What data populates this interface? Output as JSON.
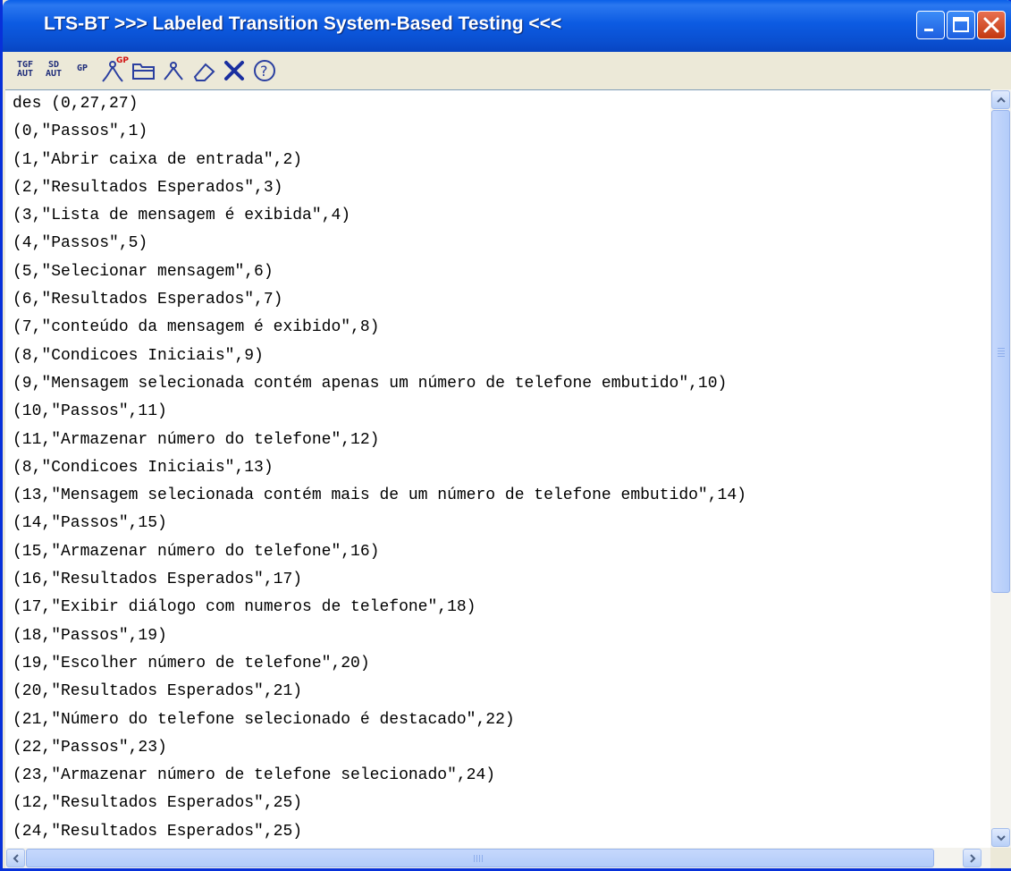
{
  "window": {
    "title": "LTS-BT >>> Labeled Transition System-Based Testing <<<",
    "accent": "#0A5FE8"
  },
  "toolbar": {
    "items": [
      {
        "label_top": "TGF",
        "label_bottom": "AUT",
        "icon": "tgf-aut-icon"
      },
      {
        "label_top": "SD",
        "label_bottom": "AUT",
        "icon": "sd-aut-icon"
      },
      {
        "label_top": "GP",
        "label_bottom": "",
        "icon": "gp-icon"
      },
      {
        "label_top": "GP",
        "label_bottom": "",
        "icon": "graph-gp-icon"
      },
      {
        "label_top": "",
        "label_bottom": "",
        "icon": "open-folder-icon"
      },
      {
        "label_top": "",
        "label_bottom": "",
        "icon": "graph-icon"
      },
      {
        "label_top": "",
        "label_bottom": "",
        "icon": "eraser-icon"
      },
      {
        "label_top": "",
        "label_bottom": "",
        "icon": "close-x-icon"
      },
      {
        "label_top": "",
        "label_bottom": "",
        "icon": "help-icon"
      }
    ]
  },
  "editor": {
    "lines": [
      "des (0,27,27)",
      "(0,\"Passos\",1)",
      "(1,\"Abrir caixa de entrada\",2)",
      "(2,\"Resultados Esperados\",3)",
      "(3,\"Lista de mensagem é exibida\",4)",
      "(4,\"Passos\",5)",
      "(5,\"Selecionar mensagem\",6)",
      "(6,\"Resultados Esperados\",7)",
      "(7,\"conteúdo da mensagem é exibido\",8)",
      "(8,\"Condicoes Iniciais\",9)",
      "(9,\"Mensagem selecionada contém apenas um número de telefone embutido\",10)",
      "(10,\"Passos\",11)",
      "(11,\"Armazenar número do telefone\",12)",
      "(8,\"Condicoes Iniciais\",13)",
      "(13,\"Mensagem selecionada contém mais de um número de telefone embutido\",14)",
      "(14,\"Passos\",15)",
      "(15,\"Armazenar número do telefone\",16)",
      "(16,\"Resultados Esperados\",17)",
      "(17,\"Exibir diálogo com numeros de telefone\",18)",
      "(18,\"Passos\",19)",
      "(19,\"Escolher número de telefone\",20)",
      "(20,\"Resultados Esperados\",21)",
      "(21,\"Número do telefone selecionado é destacado\",22)",
      "(22,\"Passos\",23)",
      "(23,\"Armazenar número de telefone selecionado\",24)",
      "(12,\"Resultados Esperados\",25)",
      "(24,\"Resultados Esperados\",25)"
    ]
  }
}
